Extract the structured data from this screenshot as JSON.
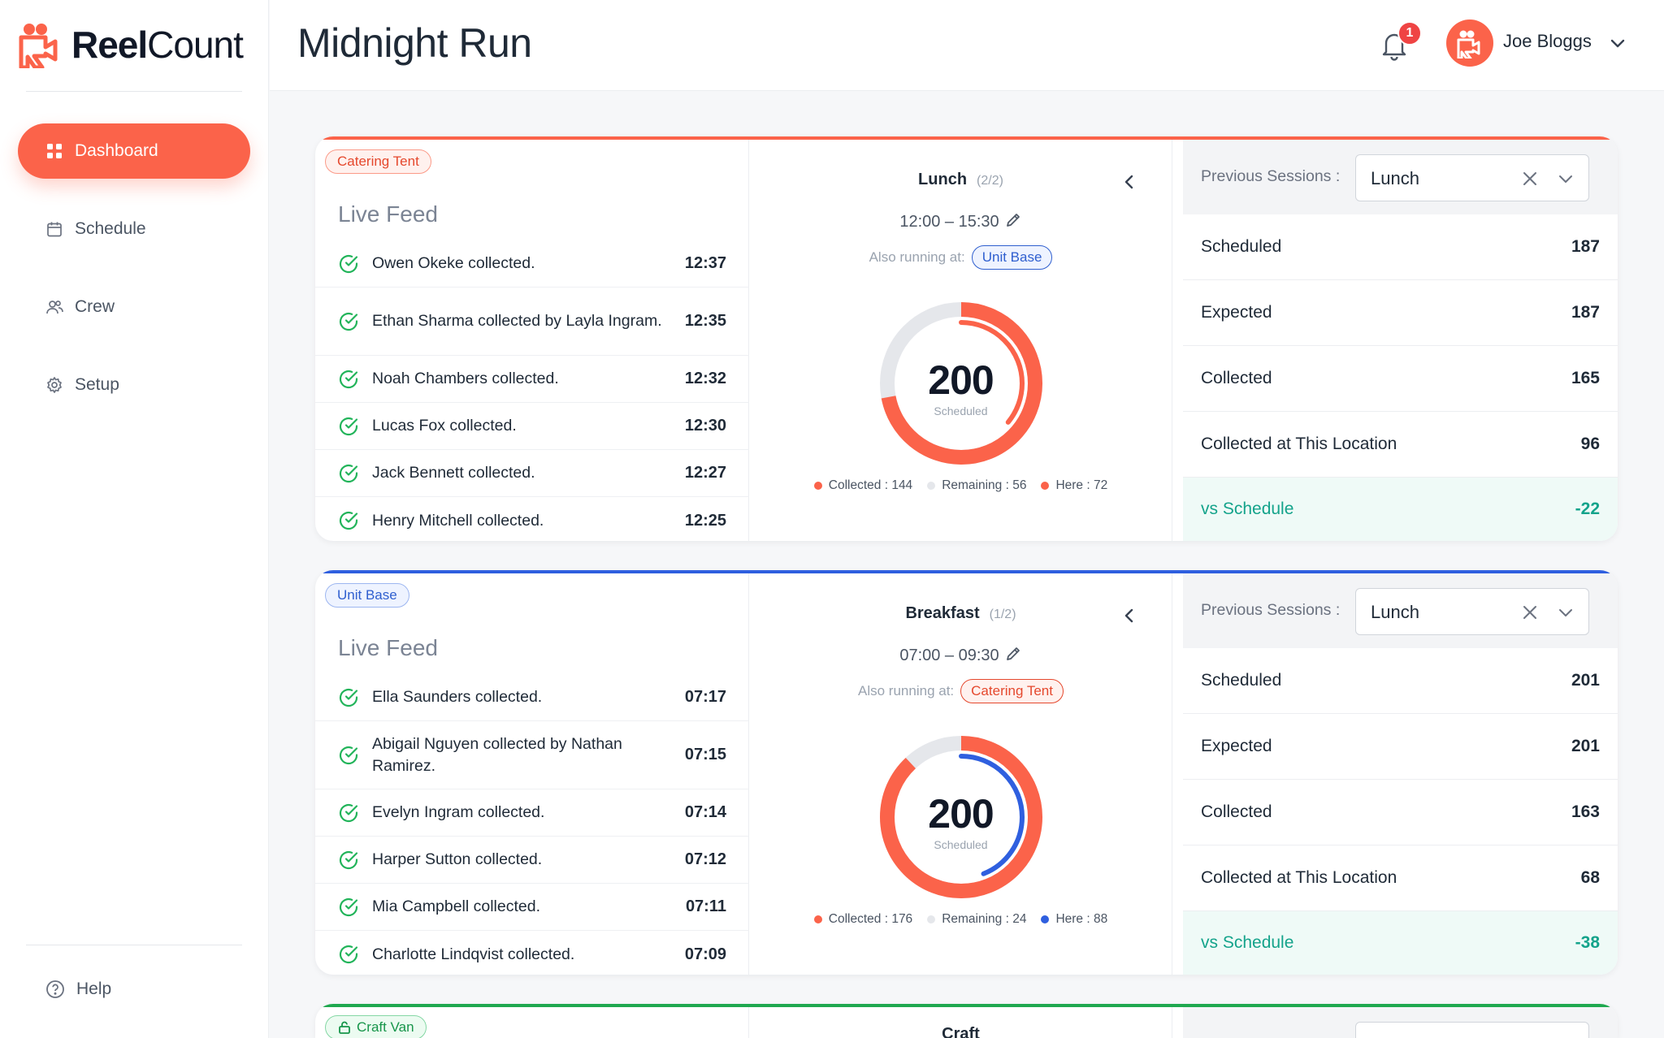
{
  "app": {
    "logo_bold": "Reel",
    "logo_regular": "Count"
  },
  "page_title": "Midnight Run",
  "nav": [
    {
      "label": "Dashboard",
      "icon": "grid-icon",
      "active": true
    },
    {
      "label": "Schedule",
      "icon": "calendar-icon"
    },
    {
      "label": "Crew",
      "icon": "users-icon"
    },
    {
      "label": "Setup",
      "icon": "gear-icon"
    }
  ],
  "help_label": "Help",
  "header": {
    "notification_count": "1",
    "user_name": "Joe Bloggs"
  },
  "colors": {
    "orange": "#fb634a",
    "blue": "#2f5fdf",
    "green": "#1fa84f",
    "gray": "#e5e7eb",
    "teal": "#14a38b"
  },
  "cards": [
    {
      "location": "Catering Tent",
      "feed_title": "Live Feed",
      "feed": [
        {
          "text": "Owen Okeke collected.",
          "time": "12:37"
        },
        {
          "text": "Ethan Sharma collected by Layla Ingram.",
          "time": "12:35"
        },
        {
          "text": "Noah Chambers collected.",
          "time": "12:32"
        },
        {
          "text": "Lucas Fox collected.",
          "time": "12:30"
        },
        {
          "text": "Jack Bennett collected.",
          "time": "12:27"
        },
        {
          "text": "Henry Mitchell collected.",
          "time": "12:25"
        }
      ],
      "session": {
        "name": "Lunch",
        "count": "(2/2)",
        "time": "12:00 – 15:30",
        "also_label": "Also running at:",
        "also_location": "Unit Base"
      },
      "gauge": {
        "value": "200",
        "label": "Scheduled",
        "scheduled": 200,
        "collected": 144,
        "here": 72
      },
      "legend": {
        "collected": "Collected : 144",
        "remaining": "Remaining : 56",
        "here": "Here : 72"
      },
      "previous": {
        "label": "Previous Sessions :",
        "value": "Lunch"
      },
      "stats": [
        {
          "label": "Scheduled",
          "value": "187"
        },
        {
          "label": "Expected",
          "value": "187"
        },
        {
          "label": "Collected",
          "value": "165"
        },
        {
          "label": "Collected at This Location",
          "value": "96"
        },
        {
          "label": "vs Schedule",
          "value": "-22"
        }
      ]
    },
    {
      "location": "Unit Base",
      "feed_title": "Live Feed",
      "feed": [
        {
          "text": "Ella Saunders collected.",
          "time": "07:17"
        },
        {
          "text": "Abigail Nguyen collected by Nathan Ramirez.",
          "time": "07:15"
        },
        {
          "text": "Evelyn Ingram collected.",
          "time": "07:14"
        },
        {
          "text": "Harper Sutton collected.",
          "time": "07:12"
        },
        {
          "text": "Mia Campbell collected.",
          "time": "07:11"
        },
        {
          "text": "Charlotte Lindqvist collected.",
          "time": "07:09"
        }
      ],
      "session": {
        "name": "Breakfast",
        "count": "(1/2)",
        "time": "07:00 – 09:30",
        "also_label": "Also running at:",
        "also_location": "Catering Tent"
      },
      "gauge": {
        "value": "200",
        "label": "Scheduled",
        "scheduled": 200,
        "collected": 176,
        "here": 88
      },
      "legend": {
        "collected": "Collected : 176",
        "remaining": "Remaining : 24",
        "here": "Here : 88"
      },
      "previous": {
        "label": "Previous Sessions :",
        "value": "Lunch"
      },
      "stats": [
        {
          "label": "Scheduled",
          "value": "201"
        },
        {
          "label": "Expected",
          "value": "201"
        },
        {
          "label": "Collected",
          "value": "163"
        },
        {
          "label": "Collected at This Location",
          "value": "68"
        },
        {
          "label": "vs Schedule",
          "value": "-38"
        }
      ]
    },
    {
      "location": "Craft Van",
      "session": {
        "name": "Craft"
      }
    }
  ]
}
